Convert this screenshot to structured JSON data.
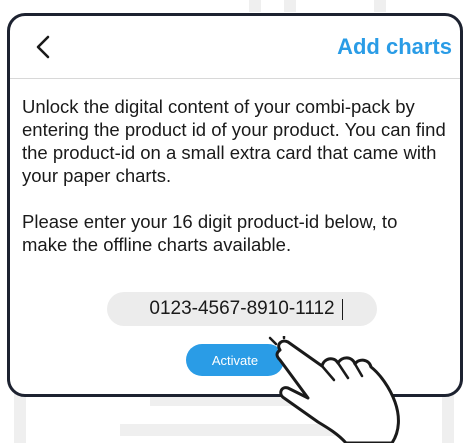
{
  "header": {
    "back_icon": "chevron-left-icon",
    "title": "Add charts"
  },
  "body": {
    "paragraph_1": "Unlock the digital content of your combi-pack by entering the product id of your product. You can find the product-id on a small extra card that came with your paper charts.",
    "paragraph_2": "Please enter your 16 digit product-id below, to make the offline charts available."
  },
  "product_input": {
    "value": "0123-4567-8910-1112"
  },
  "activate_button": {
    "label": "Activate"
  },
  "pointer": {
    "icon": "hand-pointer-icon"
  },
  "colors": {
    "accent": "#2a9ce6",
    "frame": "#1d2230",
    "input_bg": "#ececec"
  }
}
